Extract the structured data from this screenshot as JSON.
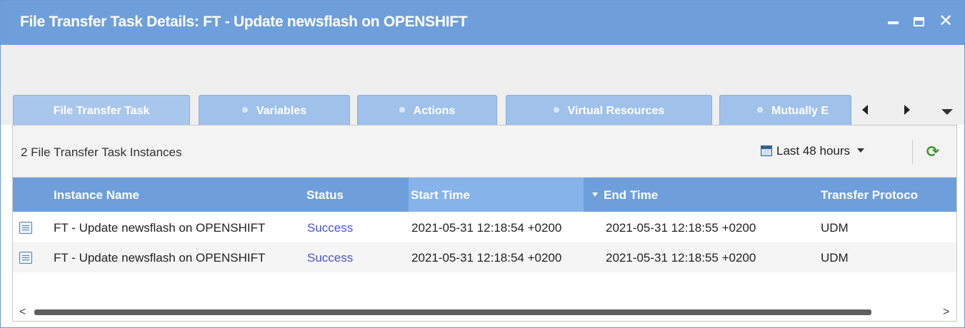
{
  "window": {
    "title": "File Transfer Task Details: FT - Update newsflash on OPENSHIFT",
    "close_label": "✕"
  },
  "tabs": [
    {
      "label": "File Transfer Task"
    },
    {
      "label": "Variables"
    },
    {
      "label": "Actions"
    },
    {
      "label": "Virtual Resources"
    },
    {
      "label": "Mutually E"
    }
  ],
  "panel": {
    "instances_count": "2 File Transfer Task Instances",
    "date_filter": "Last 48 hours",
    "refresh_glyph": "⟳"
  },
  "grid": {
    "columns": [
      "Instance Name",
      "Status",
      "Start Time",
      "End Time",
      "Transfer Protoco"
    ],
    "sorted_column": "End Time",
    "rows": [
      {
        "name": "FT - Update newsflash on OPENSHIFT",
        "status": "Success",
        "start": "2021-05-31 12:18:54 +0200",
        "end": "2021-05-31 12:18:55 +0200",
        "protocol": "UDM"
      },
      {
        "name": "FT - Update newsflash on OPENSHIFT",
        "status": "Success",
        "start": "2021-05-31 12:18:54 +0200",
        "end": "2021-05-31 12:18:55 +0200",
        "protocol": "UDM"
      }
    ]
  },
  "scrollbar": {
    "left_arrow": "<",
    "right_arrow": ">"
  },
  "colors": {
    "titlebar": "#6e9fdb",
    "tab": "#9fc1ea",
    "status_link": "#4a55c9",
    "refresh": "#3f9a2b"
  }
}
